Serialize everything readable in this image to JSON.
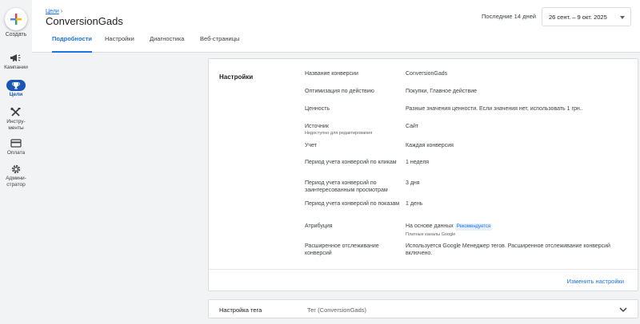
{
  "rail": {
    "create_label": "Создать",
    "items": [
      {
        "label": "Кампании",
        "icon": "megaphone-icon"
      },
      {
        "label": "Цели",
        "icon": "trophy-icon"
      },
      {
        "label": "Инстру-\nменты",
        "icon": "tools-icon"
      },
      {
        "label": "Оплата",
        "icon": "credit-card-icon"
      },
      {
        "label": "Админи-\nстратор",
        "icon": "gear-icon"
      }
    ]
  },
  "header": {
    "breadcrumb": "Цели",
    "breadcrumb_chevron": "›",
    "title": "ConversionGads",
    "date_label": "Последние 14 дней",
    "date_range": "26 сент. – 9 окт. 2025",
    "tabs": [
      "Подробности",
      "Настройки",
      "Диагностика",
      "Веб-страницы"
    ]
  },
  "settings": {
    "section_title": "Настройки",
    "rows": [
      {
        "key": "Название конверсии",
        "value": "ConversionGads"
      },
      {
        "key": "Оптимизация по действию",
        "value": "Покупки, Главное действие"
      },
      {
        "key": "Ценность",
        "value": "Разные значения ценности. Если значения нет, использовать 1 грн.."
      },
      {
        "key": "Источник",
        "sub": "Недоступно для редактирования",
        "value": "Сайт"
      },
      {
        "key": "Учет",
        "value": "Каждая конверсия"
      },
      {
        "key": "Период учета конверсий по кликам",
        "value": "1 неделя"
      },
      {
        "key": "Период учета конверсий по заинтересованным просмотрам",
        "value": "3 дня"
      },
      {
        "key": "Период учета конверсий по показам",
        "value": "1 день"
      },
      {
        "key": "Атрибуция",
        "value": "На основе данных",
        "badge": "Рекомендуется",
        "subvalue": "Платные каналы Google"
      },
      {
        "key": "Расширенное отслеживание конверсий",
        "value": "Используется Google Менеджер тегов.  Расширенное отслеживание конверсий включено."
      }
    ],
    "edit_link": "Изменить настройки"
  },
  "tag_setup": {
    "label": "Настройка тега",
    "value": "Тег (ConversionGads)"
  },
  "colors": {
    "accent": "#1a73e8",
    "rail_active": "#1a56b8",
    "background": "#f1f3f4"
  }
}
